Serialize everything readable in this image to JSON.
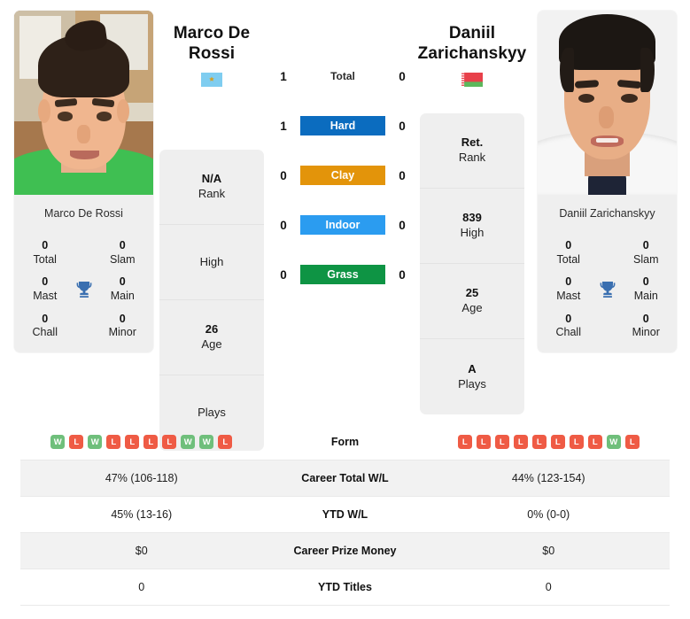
{
  "players": {
    "left": {
      "name": "Marco De Rossi",
      "name_line1": "Marco De",
      "name_line2": "Rossi",
      "flag": "san-marino-flag",
      "rank": "N/A",
      "rank_label": "Rank",
      "high": "",
      "high_label": "High",
      "age": "26",
      "age_label": "Age",
      "plays": "",
      "plays_label": "Plays",
      "titles": {
        "total": "0",
        "total_label": "Total",
        "slam": "0",
        "slam_label": "Slam",
        "mast": "0",
        "mast_label": "Mast",
        "main": "0",
        "main_label": "Main",
        "chall": "0",
        "chall_label": "Chall",
        "minor": "0",
        "minor_label": "Minor"
      },
      "form": [
        "W",
        "L",
        "W",
        "L",
        "L",
        "L",
        "L",
        "W",
        "W",
        "L"
      ],
      "career_total_wl": "47% (106-118)",
      "ytd_wl": "45% (13-16)",
      "career_prize_money": "$0",
      "ytd_titles": "0"
    },
    "right": {
      "name": "Daniil Zarichanskyy",
      "name_line1": "Daniil",
      "name_line2": "Zarichanskyy",
      "flag": "belarus-flag",
      "rank": "Ret.",
      "rank_label": "Rank",
      "high": "839",
      "high_label": "High",
      "age": "25",
      "age_label": "Age",
      "plays": "A",
      "plays_label": "Plays",
      "titles": {
        "total": "0",
        "total_label": "Total",
        "slam": "0",
        "slam_label": "Slam",
        "mast": "0",
        "mast_label": "Mast",
        "main": "0",
        "main_label": "Main",
        "chall": "0",
        "chall_label": "Chall",
        "minor": "0",
        "minor_label": "Minor"
      },
      "form": [
        "L",
        "L",
        "L",
        "L",
        "L",
        "L",
        "L",
        "L",
        "W",
        "L"
      ],
      "career_total_wl": "44% (123-154)",
      "ytd_wl": "0% (0-0)",
      "career_prize_money": "$0",
      "ytd_titles": "0"
    }
  },
  "head_to_head": {
    "rows": [
      {
        "label": "Total",
        "left": "1",
        "right": "0",
        "style": "plain",
        "color": ""
      },
      {
        "label": "Hard",
        "left": "1",
        "right": "0",
        "style": "pill",
        "color": "#0b6cbf"
      },
      {
        "label": "Clay",
        "left": "0",
        "right": "0",
        "style": "pill",
        "color": "#e3940a"
      },
      {
        "label": "Indoor",
        "left": "0",
        "right": "0",
        "style": "pill",
        "color": "#2b9cf0"
      },
      {
        "label": "Grass",
        "left": "0",
        "right": "0",
        "style": "pill",
        "color": "#0e9444"
      }
    ]
  },
  "stats_table": {
    "rows": [
      {
        "key": "Form",
        "left": "",
        "right": "",
        "type": "form",
        "shaded": false
      },
      {
        "key": "Career Total W/L",
        "left": "47% (106-118)",
        "right": "44% (123-154)",
        "type": "text",
        "shaded": true
      },
      {
        "key": "YTD W/L",
        "left": "45% (13-16)",
        "right": "0% (0-0)",
        "type": "text",
        "shaded": false
      },
      {
        "key": "Career Prize Money",
        "left": "$0",
        "right": "$0",
        "type": "text",
        "shaded": true
      },
      {
        "key": "YTD Titles",
        "left": "0",
        "right": "0",
        "type": "text",
        "shaded": false
      }
    ]
  },
  "colors": {
    "hard": "#0b6cbf",
    "clay": "#e3940a",
    "indoor": "#2b9cf0",
    "grass": "#0e9444",
    "win": "#6fbf7b",
    "loss": "#ef5b45",
    "trophy": "#3a6fb0",
    "card_bg": "#efefef",
    "row_shade": "#f2f2f2"
  }
}
